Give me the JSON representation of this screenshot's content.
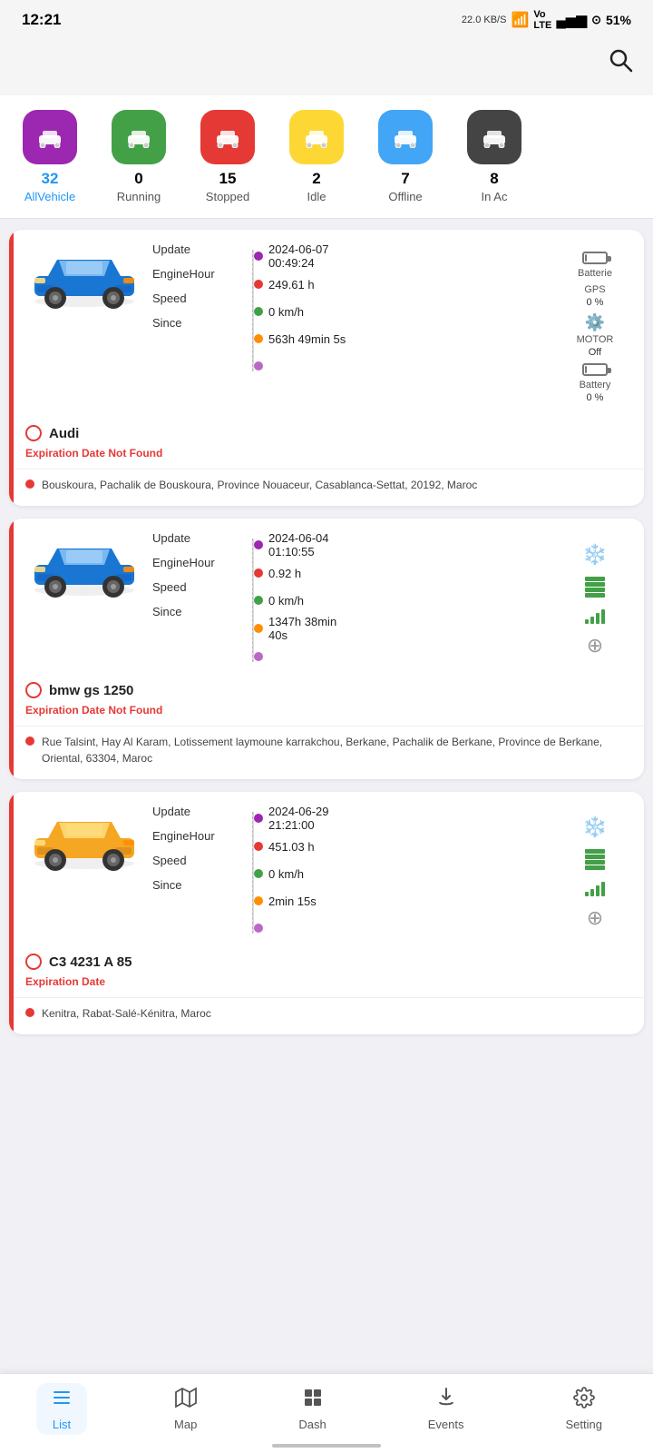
{
  "statusBar": {
    "time": "12:21",
    "network": "22.0 KB/S",
    "battery": "51%"
  },
  "filterTabs": [
    {
      "id": "all",
      "count": "32",
      "label": "AllVehicle",
      "color": "#9c27b0",
      "active": true
    },
    {
      "id": "running",
      "count": "0",
      "label": "Running",
      "color": "#43a047",
      "active": false
    },
    {
      "id": "stopped",
      "count": "15",
      "label": "Stopped",
      "color": "#e53935",
      "active": false
    },
    {
      "id": "idle",
      "count": "2",
      "label": "Idle",
      "color": "#fdd835",
      "active": false
    },
    {
      "id": "offline",
      "count": "7",
      "label": "Offline",
      "color": "#42a5f5",
      "active": false
    },
    {
      "id": "inac",
      "count": "8",
      "label": "In Ac",
      "color": "#444",
      "active": false
    }
  ],
  "vehicles": [
    {
      "name": "Audi",
      "carColor": "blue",
      "expiry": "Expiration Date Not Found",
      "update": "2024-06-07\n00:49:24",
      "engineHour": "249.61 h",
      "speed": "0 km/h",
      "since": "563h 49min 5s",
      "dotExtra": "",
      "batterie": "Batterie",
      "gps": "GPS",
      "gpsValue": "0 %",
      "motor": "MOTOR",
      "motorState": "Off",
      "battery": "Battery",
      "batteryValue": "0 %",
      "location": "Bouskoura, Pachalik de Bouskoura, Province Nouaceur, Casablanca-Settat, 20192, Maroc",
      "rightType": "battery_gps_motor"
    },
    {
      "name": "bmw gs 1250",
      "carColor": "blue",
      "expiry": "Expiration Date Not Found",
      "update": "2024-06-04\n01:10:55",
      "engineHour": "0.92 h",
      "speed": "0 km/h",
      "since": "1347h 38min\n40s",
      "dotExtra": "",
      "rightType": "snow_battery_signal_target",
      "location": "Rue Talsint, Hay Al Karam, Lotissement laymoune karrakchou, Berkane, Pachalik de Berkane, Province de Berkane, Oriental, 63304, Maroc"
    },
    {
      "name": "C3 4231 A 85",
      "carColor": "yellow",
      "expiry": "Expiration Date",
      "update": "2024-06-29\n21:21:00",
      "engineHour": "451.03 h",
      "speed": "0 km/h",
      "since": "2min 15s",
      "dotExtra": "",
      "rightType": "snow_battery_signal_target",
      "location": "Kenitra, Rabat-Salé-Kénitra, Maroc"
    }
  ],
  "bottomNav": [
    {
      "id": "list",
      "icon": "list",
      "label": "List",
      "active": true
    },
    {
      "id": "map",
      "icon": "map",
      "label": "Map",
      "active": false
    },
    {
      "id": "dash",
      "icon": "dash",
      "label": "Dash",
      "active": false
    },
    {
      "id": "events",
      "icon": "events",
      "label": "Events",
      "active": false
    },
    {
      "id": "setting",
      "icon": "setting",
      "label": "Setting",
      "active": false
    }
  ]
}
